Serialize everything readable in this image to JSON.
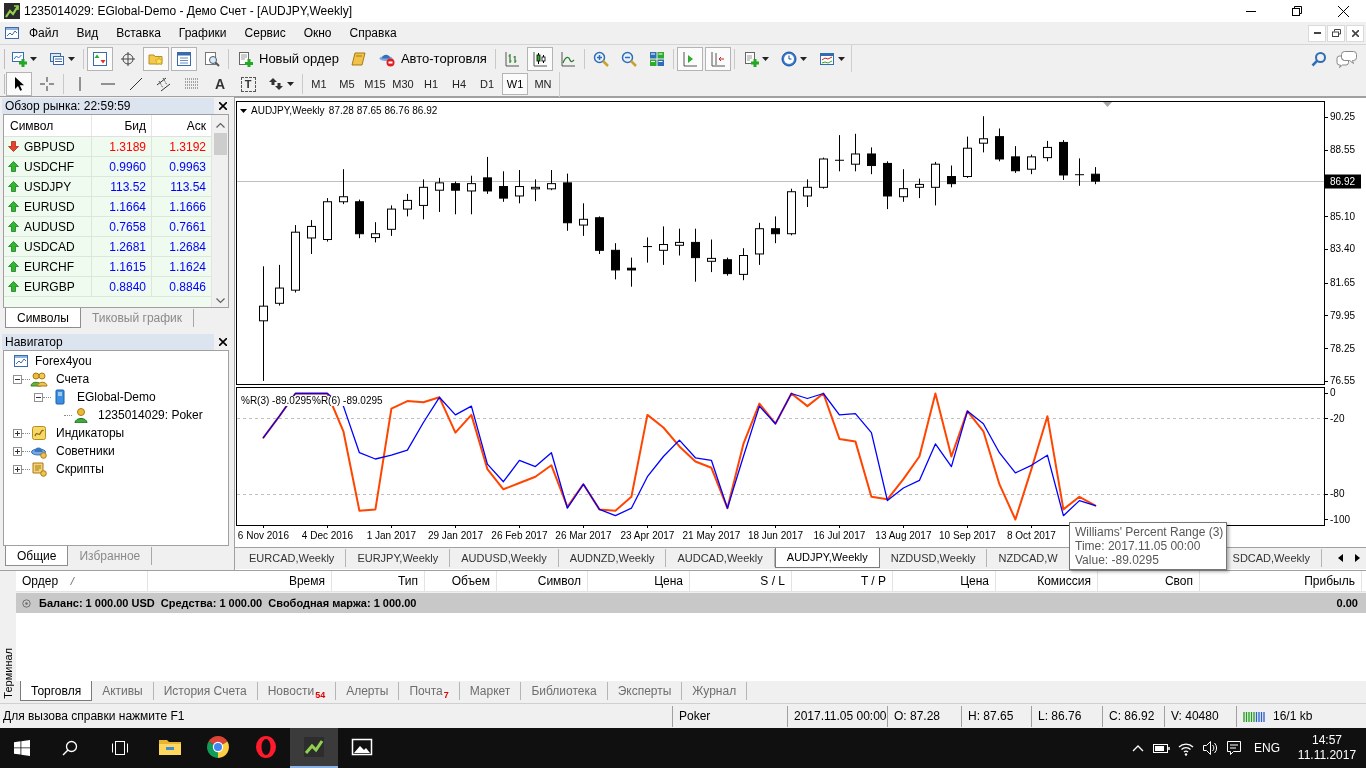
{
  "window": {
    "title": "1235014029: EGlobal-Demo - Демо Счет - [AUDJPY,Weekly]"
  },
  "menu": [
    "Файл",
    "Вид",
    "Вставка",
    "Графики",
    "Сервис",
    "Окно",
    "Справка"
  ],
  "standard_toolbar": [
    [
      {
        "kind": "icon",
        "pressed": false,
        "dropdown": true
      },
      {
        "kind": "icon",
        "pressed": false,
        "dropdown": true
      }
    ],
    [
      {
        "kind": "icon",
        "pressed": true
      },
      {
        "kind": "icon",
        "pressed": false
      },
      {
        "kind": "icon",
        "pressed": true
      },
      {
        "kind": "icon",
        "pressed": true
      },
      {
        "kind": "icon",
        "pressed": false
      }
    ],
    [
      {
        "kind": "labeled",
        "label": "Новый ордер",
        "pressed": false
      },
      {
        "kind": "icon",
        "pressed": false
      },
      {
        "kind": "labeled",
        "label": "Авто-торговля",
        "pressed": false
      }
    ],
    [
      {
        "kind": "icon",
        "pressed": false
      },
      {
        "kind": "icon",
        "pressed": true
      },
      {
        "kind": "icon",
        "pressed": false
      }
    ],
    [
      {
        "kind": "icon",
        "pressed": false
      },
      {
        "kind": "icon",
        "pressed": false
      },
      {
        "kind": "icon",
        "pressed": false
      }
    ],
    [
      {
        "kind": "icon",
        "pressed": true
      },
      {
        "kind": "icon",
        "pressed": true
      }
    ],
    [
      {
        "kind": "icon",
        "pressed": false,
        "dropdown": true
      },
      {
        "kind": "icon",
        "pressed": false,
        "dropdown": true
      },
      {
        "kind": "icon",
        "pressed": false,
        "dropdown": true
      }
    ]
  ],
  "line_studies_toolbar": [
    [
      {
        "kind": "icon",
        "pressed": true
      },
      {
        "kind": "icon",
        "pressed": false
      }
    ],
    [
      {
        "kind": "icon",
        "pressed": false
      },
      {
        "kind": "icon",
        "pressed": false
      },
      {
        "kind": "icon",
        "pressed": false
      },
      {
        "kind": "icon",
        "pressed": false
      },
      {
        "kind": "icon",
        "pressed": false
      },
      {
        "kind": "glyph",
        "label": "A",
        "pressed": false
      },
      {
        "kind": "boxed",
        "label": "T",
        "pressed": false
      },
      {
        "kind": "icon",
        "pressed": false,
        "dropdown": true
      }
    ]
  ],
  "timeframes": [
    {
      "label": "M1",
      "selected": false
    },
    {
      "label": "M5",
      "selected": false
    },
    {
      "label": "M15",
      "selected": false
    },
    {
      "label": "M30",
      "selected": false
    },
    {
      "label": "H1",
      "selected": false
    },
    {
      "label": "H4",
      "selected": false
    },
    {
      "label": "D1",
      "selected": false
    },
    {
      "label": "W1",
      "selected": true
    },
    {
      "label": "MN",
      "selected": false
    }
  ],
  "market_watch": {
    "title": "Обзор рынка: 22:59:59",
    "columns": [
      "Символ",
      "Бид",
      "Аск"
    ],
    "rows": [
      {
        "symbol": "GBPUSD",
        "bid": "1.3189",
        "ask": "1.3192",
        "kind": "down"
      },
      {
        "symbol": "USDCHF",
        "bid": "0.9960",
        "ask": "0.9963",
        "kind": "up"
      },
      {
        "symbol": "USDJPY",
        "bid": "113.52",
        "ask": "113.54",
        "kind": "up"
      },
      {
        "symbol": "EURUSD",
        "bid": "1.1664",
        "ask": "1.1666",
        "kind": "up"
      },
      {
        "symbol": "AUDUSD",
        "bid": "0.7658",
        "ask": "0.7661",
        "kind": "up"
      },
      {
        "symbol": "USDCAD",
        "bid": "1.2681",
        "ask": "1.2684",
        "kind": "up"
      },
      {
        "symbol": "EURCHF",
        "bid": "1.1615",
        "ask": "1.1624",
        "kind": "up"
      },
      {
        "symbol": "EURGBP",
        "bid": "0.8840",
        "ask": "0.8846",
        "kind": "up"
      }
    ],
    "tabs": [
      {
        "label": "Символы",
        "selected": true
      },
      {
        "label": "Тиковый график",
        "selected": false
      }
    ]
  },
  "navigator": {
    "title": "Навигатор",
    "tree": [
      {
        "label": "Forex4you",
        "kind": "broker",
        "children": [
          {
            "label": "Счета",
            "kind": "accounts",
            "expanded": true,
            "children": [
              {
                "label": "EGlobal-Demo",
                "kind": "server",
                "expanded": true,
                "children": [
                  {
                    "label": "1235014029: Poker",
                    "kind": "account"
                  }
                ]
              }
            ]
          },
          {
            "label": "Индикаторы",
            "kind": "indicators",
            "expanded": false
          },
          {
            "label": "Советники",
            "kind": "experts",
            "expanded": false
          },
          {
            "label": "Скрипты",
            "kind": "scripts",
            "expanded": false
          }
        ]
      }
    ],
    "tabs": [
      {
        "label": "Общие",
        "selected": true
      },
      {
        "label": "Избранное",
        "selected": false
      }
    ]
  },
  "chart": {
    "chart_data": [
      {
        "type": "candlestick",
        "title": "AUDJPY,Weekly",
        "subtitle": "87.28 87.65 86.76 86.92",
        "x": [
          "2016-11-06",
          "2016-11-13",
          "2016-11-20",
          "2016-11-27",
          "2016-12-04",
          "2016-12-11",
          "2016-12-18",
          "2016-12-25",
          "2017-01-01",
          "2017-01-08",
          "2017-01-15",
          "2017-01-22",
          "2017-01-29",
          "2017-02-05",
          "2017-02-12",
          "2017-02-19",
          "2017-02-26",
          "2017-03-05",
          "2017-03-12",
          "2017-03-19",
          "2017-03-26",
          "2017-04-02",
          "2017-04-09",
          "2017-04-16",
          "2017-04-23",
          "2017-04-30",
          "2017-05-07",
          "2017-05-14",
          "2017-05-21",
          "2017-05-28",
          "2017-06-04",
          "2017-06-11",
          "2017-06-18",
          "2017-06-25",
          "2017-07-02",
          "2017-07-09",
          "2017-07-16",
          "2017-07-23",
          "2017-07-30",
          "2017-08-06",
          "2017-08-13",
          "2017-08-20",
          "2017-08-27",
          "2017-09-03",
          "2017-09-10",
          "2017-09-17",
          "2017-09-24",
          "2017-10-01",
          "2017-10-08",
          "2017-10-15",
          "2017-10-22",
          "2017-10-29",
          "2017-11-05"
        ],
        "ohlc": [
          [
            79.67,
            82.5,
            76.55,
            80.43
          ],
          [
            80.58,
            82.57,
            80.46,
            81.37
          ],
          [
            81.26,
            84.64,
            81.14,
            84.27
          ],
          [
            83.97,
            84.9,
            83.14,
            84.57
          ],
          [
            83.89,
            86.04,
            83.78,
            85.85
          ],
          [
            85.85,
            87.54,
            85.73,
            86.11
          ],
          [
            85.85,
            85.96,
            83.96,
            84.19
          ],
          [
            83.99,
            84.79,
            83.74,
            84.19
          ],
          [
            84.42,
            85.66,
            84.08,
            85.47
          ],
          [
            85.47,
            86.26,
            85.09,
            85.92
          ],
          [
            85.66,
            87.01,
            84.94,
            86.6
          ],
          [
            86.45,
            87.09,
            85.32,
            86.83
          ],
          [
            86.79,
            86.9,
            85.2,
            86.45
          ],
          [
            86.41,
            87.2,
            85.2,
            86.79
          ],
          [
            87.09,
            88.18,
            86.26,
            86.41
          ],
          [
            86.64,
            87.43,
            85.85,
            86.04
          ],
          [
            86.15,
            87.5,
            85.77,
            86.64
          ],
          [
            86.52,
            87.01,
            85.88,
            86.6
          ],
          [
            86.52,
            87.5,
            86.45,
            86.79
          ],
          [
            86.83,
            87.31,
            84.34,
            84.76
          ],
          [
            84.64,
            85.77,
            84.08,
            84.94
          ],
          [
            85.02,
            85.09,
            83.14,
            83.33
          ],
          [
            83.33,
            83.7,
            81.82,
            82.31
          ],
          [
            82.4,
            82.95,
            81.44,
            82.31
          ],
          [
            83.52,
            84.0,
            82.69,
            83.55
          ],
          [
            83.33,
            84.57,
            82.57,
            83.63
          ],
          [
            83.59,
            84.45,
            83.06,
            83.74
          ],
          [
            83.74,
            84.45,
            81.7,
            82.95
          ],
          [
            82.76,
            83.89,
            82.2,
            82.91
          ],
          [
            82.84,
            82.95,
            82.01,
            82.12
          ],
          [
            82.08,
            83.44,
            81.78,
            83.06
          ],
          [
            83.14,
            84.76,
            82.57,
            84.45
          ],
          [
            84.45,
            85.09,
            83.7,
            84.19
          ],
          [
            84.19,
            86.53,
            84.11,
            86.37
          ],
          [
            86.15,
            87.01,
            85.58,
            86.6
          ],
          [
            86.6,
            88.14,
            86.53,
            88.07
          ],
          [
            87.99,
            89.31,
            87.43,
            88.03
          ],
          [
            87.8,
            89.38,
            87.43,
            88.33
          ],
          [
            88.33,
            88.67,
            87.28,
            87.73
          ],
          [
            87.84,
            87.95,
            85.47,
            86.15
          ],
          [
            86.11,
            87.54,
            85.85,
            86.53
          ],
          [
            86.6,
            87.05,
            86.04,
            86.75
          ],
          [
            86.6,
            87.92,
            85.66,
            87.8
          ],
          [
            87.16,
            87.73,
            86.6,
            86.79
          ],
          [
            87.16,
            89.23,
            87.09,
            88.63
          ],
          [
            88.89,
            90.29,
            88.41,
            89.12
          ],
          [
            89.23,
            89.65,
            87.95,
            88.07
          ],
          [
            88.18,
            88.74,
            87.35,
            87.46
          ],
          [
            87.54,
            88.29,
            87.28,
            88.18
          ],
          [
            88.14,
            89.01,
            87.95,
            88.67
          ],
          [
            88.93,
            89.05,
            86.98,
            87.24
          ],
          [
            87.24,
            88.1,
            86.68,
            87.28
          ],
          [
            87.28,
            87.65,
            86.76,
            86.92
          ]
        ],
        "xlim": [
          "2016-10-25",
          "2018-02-13"
        ],
        "ylim": [
          76.39,
          91.08
        ],
        "yticks": [
          90.25,
          88.55,
          {
            "value": 85.1,
            "label": "85.10"
          },
          {
            "value": 83.4,
            "label": "83.40"
          },
          81.65,
          79.95,
          78.25,
          76.55
        ],
        "tick_labels": "y",
        "ref_lines": [
          {
            "axis": "y",
            "value": 86.92,
            "label": "86.92",
            "color": "#c0c0c0"
          }
        ]
      },
      {
        "type": "line",
        "x": [
          "2016-11-06",
          "2016-11-13",
          "2016-11-20",
          "2016-11-27",
          "2016-12-04",
          "2016-12-11",
          "2016-12-18",
          "2016-12-25",
          "2017-01-01",
          "2017-01-08",
          "2017-01-15",
          "2017-01-22",
          "2017-01-29",
          "2017-02-05",
          "2017-02-12",
          "2017-02-19",
          "2017-02-26",
          "2017-03-05",
          "2017-03-12",
          "2017-03-19",
          "2017-03-26",
          "2017-04-02",
          "2017-04-09",
          "2017-04-16",
          "2017-04-23",
          "2017-04-30",
          "2017-05-07",
          "2017-05-14",
          "2017-05-21",
          "2017-05-28",
          "2017-06-04",
          "2017-06-11",
          "2017-06-18",
          "2017-06-25",
          "2017-07-02",
          "2017-07-09",
          "2017-07-16",
          "2017-07-23",
          "2017-07-30",
          "2017-08-06",
          "2017-08-13",
          "2017-08-20",
          "2017-08-27",
          "2017-09-03",
          "2017-09-10",
          "2017-09-17",
          "2017-09-24",
          "2017-10-01",
          "2017-10-08",
          "2017-10-15",
          "2017-10-22",
          "2017-10-29",
          "2017-11-05"
        ],
        "series": [
          {
            "color": "#ff4500",
            "values": [
              -35,
              -18,
              0,
              0,
              0,
              -30,
              -93,
              -92,
              -12,
              -6,
              -7,
              -3,
              -31,
              -17,
              -60,
              -76,
              -71,
              -66,
              -57,
              -90,
              -72,
              -92,
              -93,
              -82,
              -17,
              -27,
              -42,
              -54,
              -59,
              -91,
              -40,
              -8,
              -24,
              0,
              -10,
              0,
              -36,
              -38,
              -82,
              -84,
              -68,
              -50,
              0,
              -50,
              -14,
              -30,
              -72,
              -100,
              -60,
              -18,
              -92,
              -82,
              -89
            ]
          },
          {
            "color": "#0000ff",
            "values": [
              -35,
              -18,
              0,
              0,
              0,
              -10,
              -47,
              -52,
              -49,
              -45,
              -23,
              -3,
              -17,
              -10,
              -56,
              -70,
              -53,
              -58,
              -47,
              -91,
              -72,
              -92,
              -97,
              -91,
              -66,
              -50,
              -37,
              -51,
              -53,
              -91,
              -50,
              -10,
              -24,
              0,
              -4,
              0,
              -17,
              -16,
              -31,
              -85,
              -75,
              -69,
              -40,
              -58,
              -14,
              -24,
              -47,
              -63,
              -57,
              -49,
              -97,
              -85,
              -89
            ]
          }
        ],
        "xlim": [
          "2016-10-25",
          "2018-02-13"
        ],
        "ylim": [
          -104.76,
          4.76
        ],
        "yticks": [
          {
            "value": 0,
            "label": "0"
          },
          {
            "value": -20,
            "label": "-20"
          },
          {
            "value": -80,
            "label": "-80"
          },
          {
            "value": -100,
            "label": "-100"
          }
        ],
        "xticks": [
          {
            "value": "2016-11-06",
            "label": "6 Nov 2016"
          },
          {
            "value": "2016-12-04",
            "label": "4 Dec 2016"
          },
          {
            "value": "2017-01-01",
            "label": "1 Jan 2017"
          },
          {
            "value": "2017-01-29",
            "label": "29 Jan 2017"
          },
          {
            "value": "2017-02-26",
            "label": "26 Feb 2017"
          },
          {
            "value": "2017-03-26",
            "label": "26 Mar 2017"
          },
          {
            "value": "2017-04-23",
            "label": "23 Apr 2017"
          },
          {
            "value": "2017-05-21",
            "label": "21 May 2017"
          },
          {
            "value": "2017-06-18",
            "label": "18 Jun 2017"
          },
          {
            "value": "2017-07-16",
            "label": "16 Jul 2017"
          },
          {
            "value": "2017-08-13",
            "label": "13 Aug 2017"
          },
          {
            "value": "2017-09-10",
            "label": "10 Sep 2017"
          },
          {
            "value": "2017-10-08",
            "label": "8 Oct 2017"
          }
        ],
        "ref_lines": [
          {
            "axis": "y",
            "value": -20,
            "color": "#c0c0c0",
            "line_style": "dashed"
          },
          {
            "axis": "y",
            "value": -80,
            "color": "#c0c0c0",
            "line_style": "dashed"
          }
        ],
        "annotations": [
          "%R(3) -89.0295",
          "%R(6) -89.0295"
        ]
      }
    ],
    "tooltip": {
      "title": "Williams' Percent Range (3)",
      "lines": [
        "Time: 2017.11.05 00:00",
        "Value: -89.0295"
      ]
    }
  },
  "chart_tabs": [
    {
      "label": "EURCAD,Weekly",
      "selected": false
    },
    {
      "label": "EURJPY,Weekly",
      "selected": false
    },
    {
      "label": "AUDUSD,Weekly",
      "selected": false
    },
    {
      "label": "AUDNZD,Weekly",
      "selected": false
    },
    {
      "label": "AUDCAD,Weekly",
      "selected": false
    },
    {
      "label": "AUDJPY,Weekly",
      "selected": true
    },
    {
      "label": "NZDUSD,Weekly",
      "selected": false
    },
    {
      "label": "NZDCAD,W",
      "selected": false
    },
    {
      "label": "SDCAD,Weekly",
      "selected": false
    }
  ],
  "terminal": {
    "label": "Терминал",
    "columns": [
      {
        "label": "Ордер",
        "sorted": true
      },
      {
        "label": "Время",
        "sorted": false
      },
      {
        "label": "Тип",
        "sorted": false
      },
      {
        "label": "Объем",
        "sorted": false
      },
      {
        "label": "Символ",
        "sorted": false
      },
      {
        "label": "Цена",
        "sorted": false
      },
      {
        "label": "S / L",
        "sorted": false
      },
      {
        "label": "T / P",
        "sorted": false
      },
      {
        "label": "Цена",
        "sorted": false
      },
      {
        "label": "Комиссия",
        "sorted": false
      },
      {
        "label": "Своп",
        "sorted": false
      },
      {
        "label": "Прибыль",
        "sorted": false
      }
    ],
    "balance": {
      "text": "Баланс: 1 000.00 USD  Средства: 1 000.00  Свободная маржа: 1 000.00",
      "profit": "0.00"
    },
    "tabs": [
      {
        "label": "Торговля",
        "selected": true
      },
      {
        "label": "Активы",
        "selected": false
      },
      {
        "label": "История Счета",
        "selected": false
      },
      {
        "label": "Новости",
        "badge": "54",
        "selected": false
      },
      {
        "label": "Алерты",
        "selected": false
      },
      {
        "label": "Почта",
        "badge": "7",
        "selected": false
      },
      {
        "label": "Маркет",
        "selected": false
      },
      {
        "label": "Библиотека",
        "selected": false
      },
      {
        "label": "Эксперты",
        "selected": false
      },
      {
        "label": "Журнал",
        "selected": false
      }
    ]
  },
  "status_bar": {
    "help": "Для вызова справки нажмите F1",
    "profile": "Poker",
    "time": "2017.11.05 00:00",
    "open": "O: 87.28",
    "high": "H: 87.65",
    "low": "L: 86.76",
    "close": "C: 86.92",
    "volume": "V: 40480",
    "traffic": "16/1 kb"
  },
  "taskbar": {
    "apps": [
      {
        "active": false
      },
      {
        "active": false
      },
      {
        "active": false
      },
      {
        "active": true
      },
      {
        "active": false
      }
    ],
    "language": "ENG",
    "time": "14:57",
    "date": "11.11.2017"
  }
}
